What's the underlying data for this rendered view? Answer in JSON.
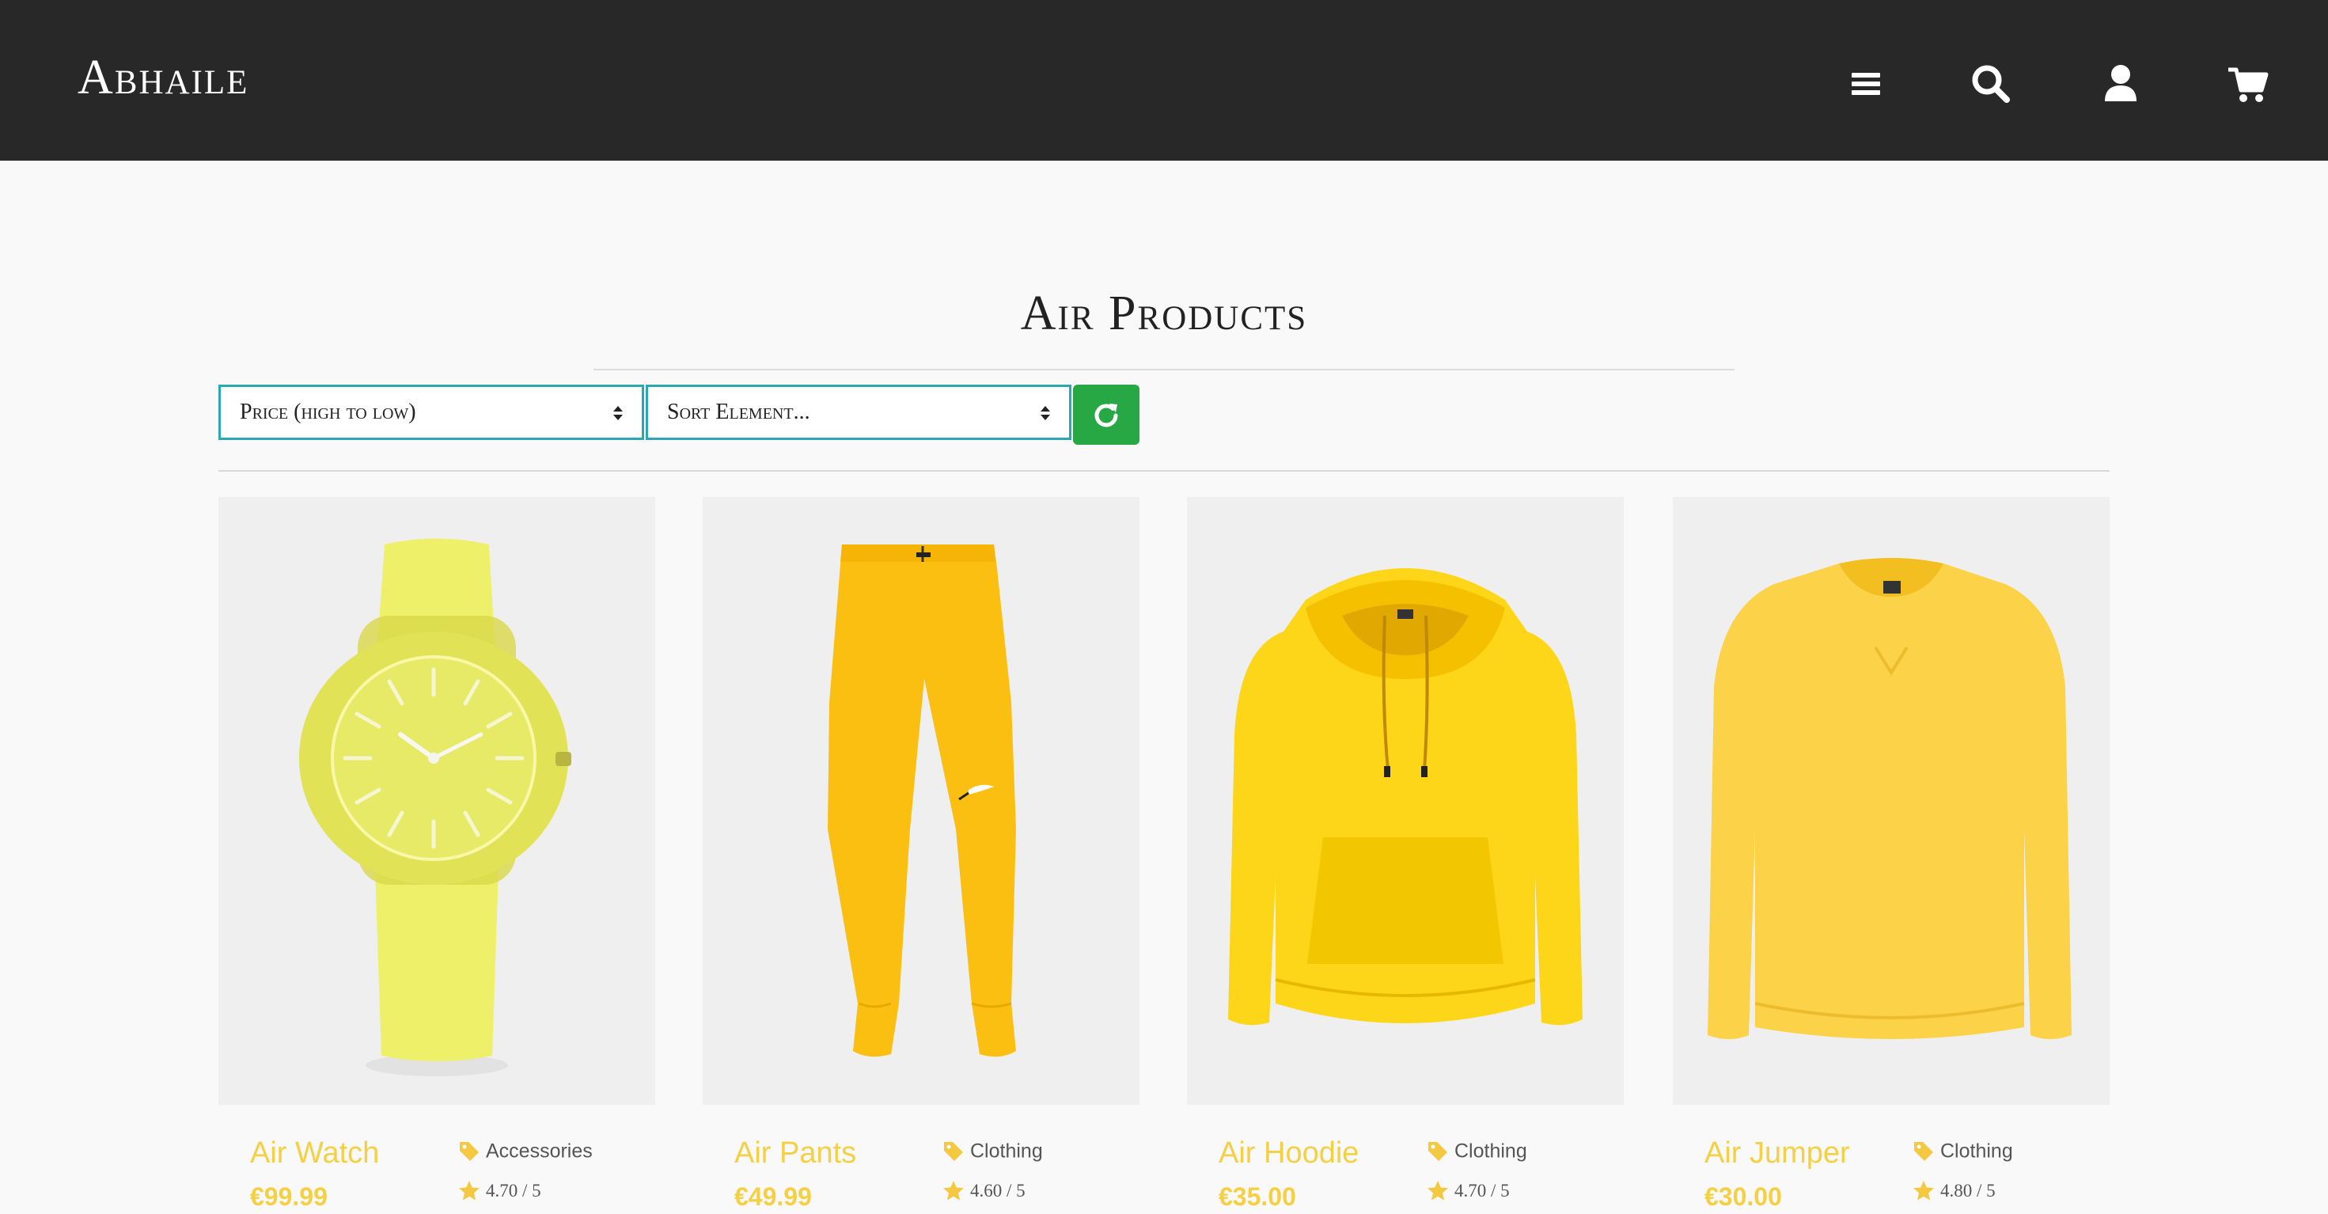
{
  "navbar": {
    "brand": "Abhaile",
    "icons": [
      "menu-icon",
      "search-icon",
      "user-icon",
      "cart-icon"
    ]
  },
  "main": {
    "title": "Air Products",
    "sort_select": {
      "value": "Price (high to low)"
    },
    "element_select": {
      "value": "Sort Element..."
    },
    "refresh_icon": "refresh-icon"
  },
  "colors": {
    "navbar_bg": "#282828",
    "accent_yellow": "#f5d045",
    "select_border": "#2aa6b6",
    "refresh_green": "#28a745"
  },
  "products": [
    {
      "name": "Air Watch",
      "price": "€99.99",
      "category": "Accessories",
      "rating": "4.70 / 5"
    },
    {
      "name": "Air Pants",
      "price": "€49.99",
      "category": "Clothing",
      "rating": "4.60 / 5"
    },
    {
      "name": "Air Hoodie",
      "price": "€35.00",
      "category": "Clothing",
      "rating": "4.70 / 5"
    },
    {
      "name": "Air Jumper",
      "price": "€30.00",
      "category": "Clothing",
      "rating": "4.80 / 5"
    }
  ]
}
